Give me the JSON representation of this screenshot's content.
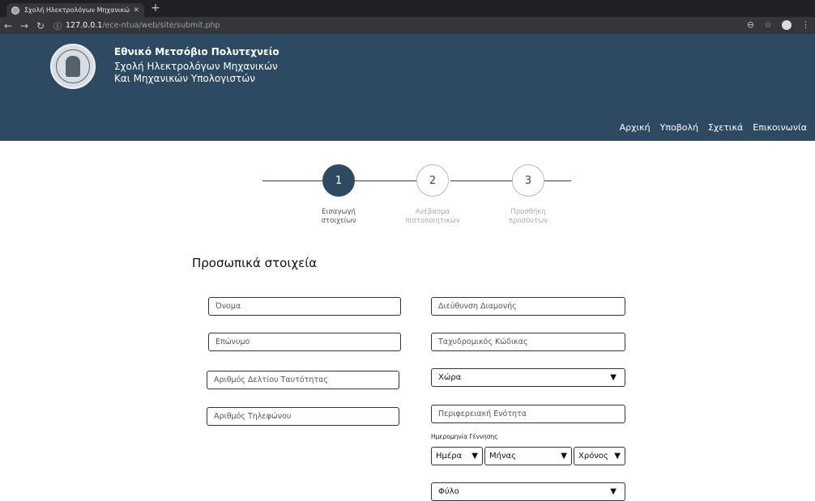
{
  "browser": {
    "tab_title": "Σχολή Ηλεκτρολόγων Μηχανικώ",
    "url_host": "127.0.0.1",
    "url_path": "/ece-ntua/web/site/submit.php"
  },
  "header": {
    "line1": "Εθνικό Μετσόβιο Πολυτεχνείο",
    "line2": "Σχολή Ηλεκτρολόγων Μηχανικών",
    "line3": "Και Μηχανικών Υπολογιστών",
    "nav": [
      "Αρχική",
      "Υποβολή",
      "Σχετικά",
      "Επικοινωνία"
    ]
  },
  "stepper": {
    "current_step": 1,
    "steps": [
      {
        "number": "1",
        "label": "Εισαγωγή\nστοιχείων"
      },
      {
        "number": "2",
        "label": "Ανέβασμα\nπιστοποιητικών"
      },
      {
        "number": "3",
        "label": "Προσθήκη\nπροσόντων"
      }
    ]
  },
  "form": {
    "section_title": "Προσωπικά στοιχεία",
    "first_name_placeholder": "Όνομα",
    "last_name_placeholder": "Επώνυμο",
    "id_number_placeholder": "Αριθμός Δελτίου Ταυτότητας",
    "phone_placeholder": "Αριθμός Τηλεφώνου",
    "address_placeholder": "Διεύθυνση Διαμονής",
    "postal_code_placeholder": "Ταχυδρομικός Κώδικας",
    "country_select": "Χώρα",
    "region_placeholder": "Περιφερειακή Ενότητα",
    "dob_label": "Ημερομηνία Γέννησης",
    "dob_day": "Ημέρα",
    "dob_month": "Μήνας",
    "dob_year": "Χρόνος",
    "gender_select": "Φύλο"
  },
  "colors": {
    "header_bg": "#2e4a63",
    "step_active": "#2e4a63"
  }
}
